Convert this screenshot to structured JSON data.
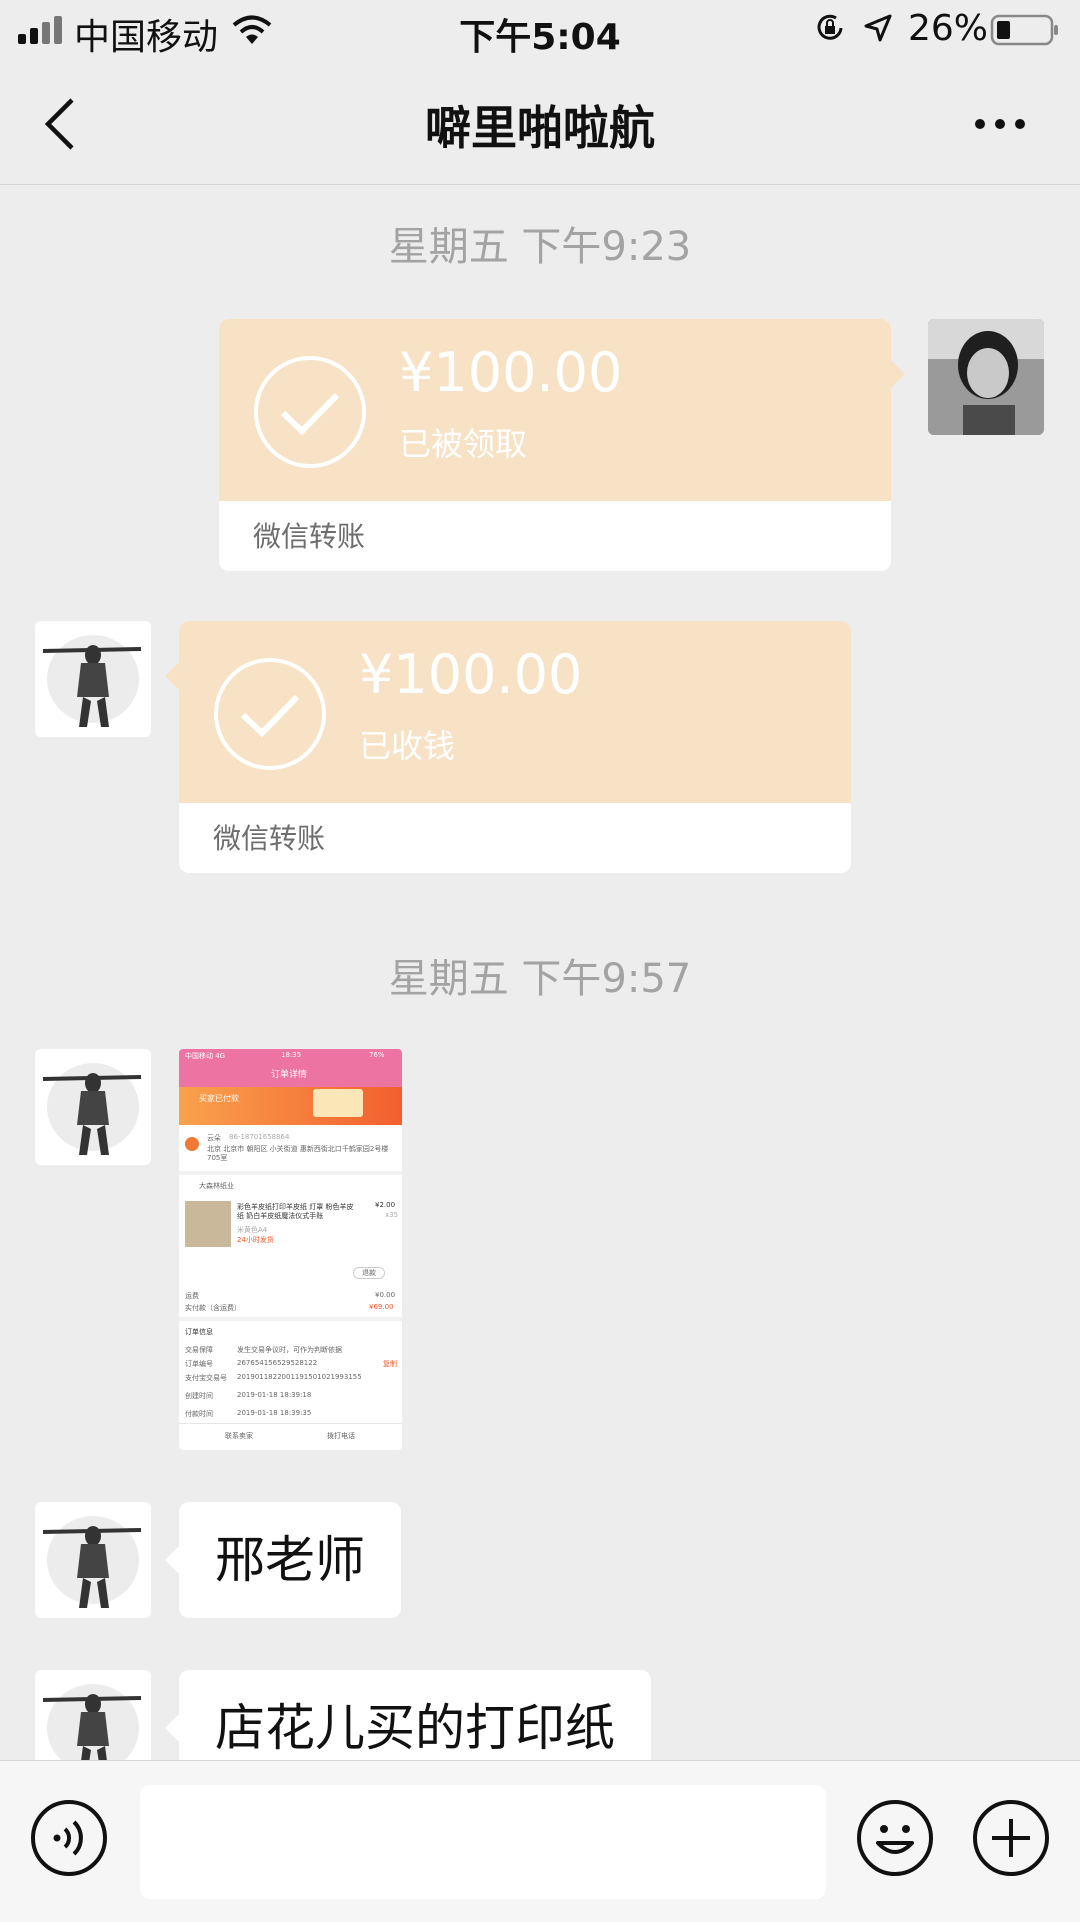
{
  "status_bar": {
    "carrier": "中国移动",
    "time": "下午5:04",
    "battery": "26%",
    "battery_level": 0.26
  },
  "nav": {
    "title": "噼里啪啦航"
  },
  "messages": {
    "stamp1": "星期五 下午9:23",
    "stamp2": "星期五 下午9:57",
    "transfer_sent": {
      "amount": "¥100.00",
      "status": "已被领取",
      "footer": "微信转账"
    },
    "transfer_received": {
      "amount": "¥100.00",
      "status": "已收钱",
      "footer": "微信转账"
    },
    "text1": "邢老师",
    "text2": "店花儿买的打印纸"
  },
  "shot": {
    "status": "中国移动 4G",
    "time": "18:35",
    "battery": "76%",
    "title": "订单详情",
    "paid_banner": "买家已付款",
    "name": "云朵",
    "phone": "86-18701658864",
    "address": "北京 北京市 朝阳区 小关街道 惠新西街北口千鹤家园2号楼705室",
    "shop": "大森林纸业",
    "product": "彩色羊皮纸打印羊皮纸 灯罩 粉色羊皮纸 奶白羊皮纸魔法仪式手账",
    "spec": "米黄色A4",
    "tag": "24小时发货",
    "price": "¥2.00",
    "qty": "x35",
    "refund": "退款",
    "shipping_label": "运费",
    "shipping": "¥0.00",
    "paid_label": "实付款（含运费）",
    "paid": "¥69.00",
    "info_title": "订单信息",
    "r1_label": "交易保障",
    "r1": "发生交易争议时，可作为判断依据",
    "r2_label": "订单编号",
    "r2": "267654156529528122",
    "r2_action": "复制",
    "r3_label": "支付宝交易号",
    "r3": "2019011822001191501021993155",
    "r4_label": "创建时间",
    "r4": "2019-01-18 18:39:18",
    "r5_label": "付款时间",
    "r5": "2019-01-18 18:39:35",
    "contact": "联系卖家",
    "call": "拨打电话"
  },
  "colors": {
    "transfer_orange": "#f7e2c5",
    "chat_background": "#ededed",
    "order_pink": "#ec73a2",
    "order_orange": "#f25f2e"
  },
  "icons": {
    "back": "chevron-left-icon",
    "more": "more-dots-icon",
    "voice": "voice-icon",
    "emoji": "emoji-icon",
    "plus": "plus-icon"
  }
}
